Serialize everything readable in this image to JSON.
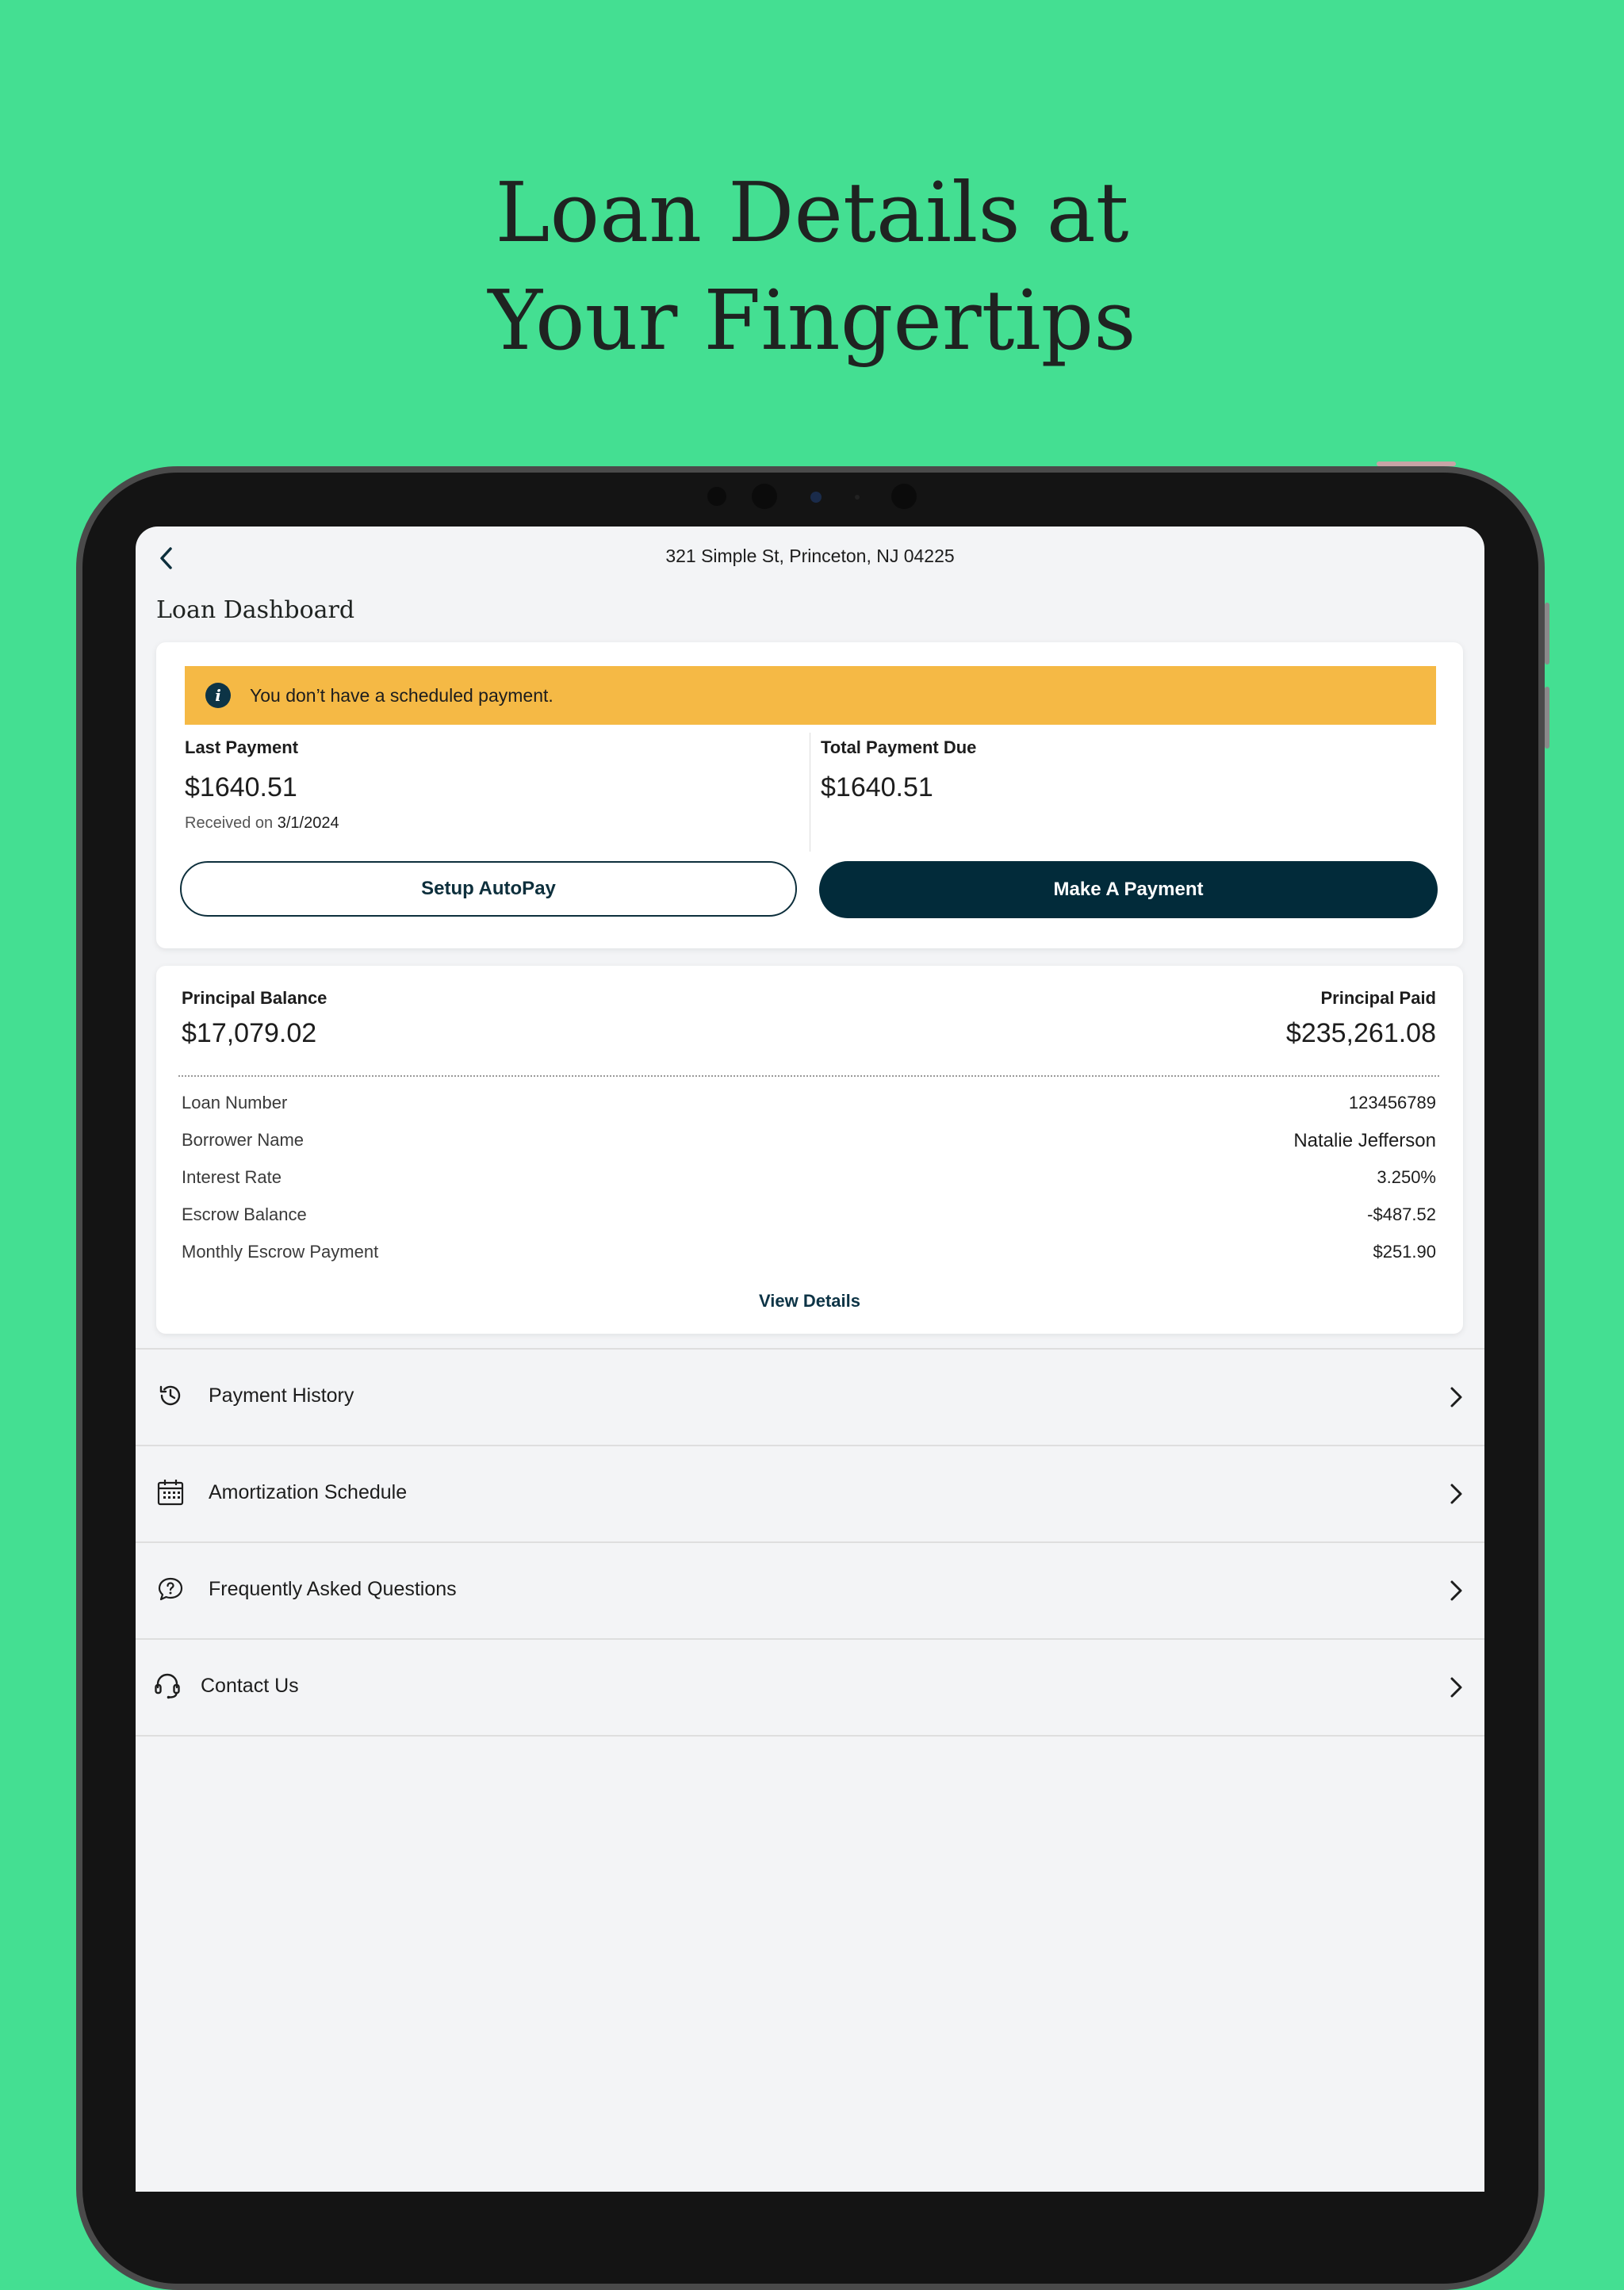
{
  "headline": {
    "line1": "Loan Details at",
    "line2": "Your Fingertips"
  },
  "topbar": {
    "address": "321 Simple St, Princeton, NJ 04225"
  },
  "page_title": "Loan Dashboard",
  "payment_card": {
    "banner_text": "You don’t have a scheduled payment.",
    "last_payment": {
      "label": "Last Payment",
      "amount": "$1640.51",
      "received_prefix": "Received on",
      "received_date": "3/1/2024"
    },
    "total_due": {
      "label": "Total Payment Due",
      "amount": "$1640.51"
    },
    "setup_autopay": "Setup AutoPay",
    "make_payment": "Make A Payment"
  },
  "loan_card": {
    "principal_balance": {
      "label": "Principal Balance",
      "value": "$17,079.02"
    },
    "principal_paid": {
      "label": "Principal Paid",
      "value": "$235,261.08"
    },
    "details": [
      {
        "key": "Loan Number",
        "value": "123456789"
      },
      {
        "key": "Borrower Name",
        "value": "Natalie Jefferson"
      },
      {
        "key": "Interest Rate",
        "value": "3.250%"
      },
      {
        "key": "Escrow Balance",
        "value": "-$487.52"
      },
      {
        "key": "Monthly Escrow Payment",
        "value": "$251.90"
      }
    ],
    "view_details": "View Details"
  },
  "menu": [
    {
      "label": "Payment History",
      "icon": "history-icon"
    },
    {
      "label": "Amortization Schedule",
      "icon": "calendar-icon"
    },
    {
      "label": "Frequently Asked Questions",
      "icon": "question-chat-icon"
    },
    {
      "label": "Contact Us",
      "icon": "headset-icon"
    }
  ],
  "colors": {
    "background": "#44df92",
    "banner": "#f5b945",
    "primary_button": "#022b3a",
    "screen": "#f3f4f6"
  }
}
